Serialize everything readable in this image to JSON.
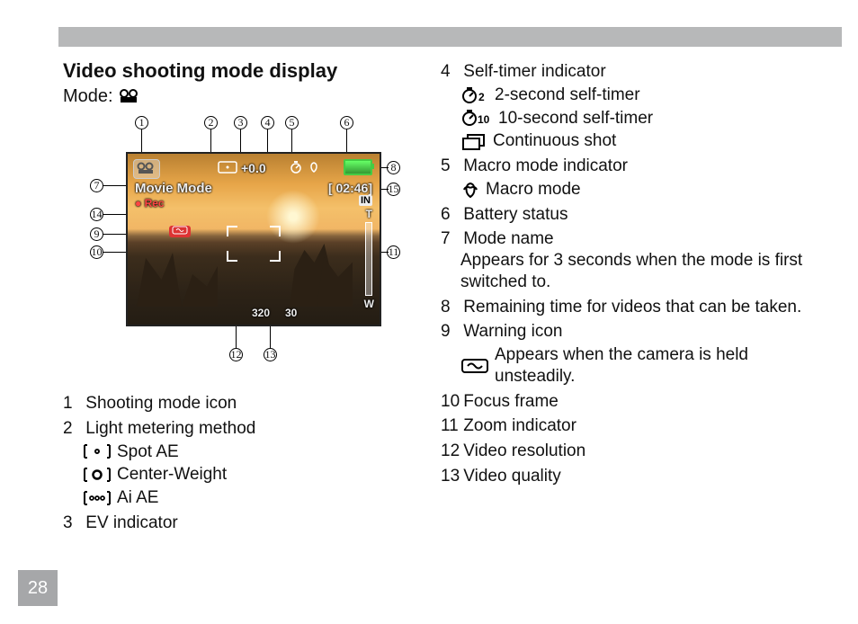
{
  "page_number": "28",
  "title": "Video shooting mode display",
  "mode_label": "Mode:",
  "lcd": {
    "mode_name": "Movie Mode",
    "rec": "Rec",
    "meter": "[ ]",
    "ev": "+0.0",
    "time": "[ 02:46]",
    "in": "IN",
    "zoom_t": "T",
    "zoom_w": "W",
    "warn": "",
    "vres": "320",
    "vq": "30"
  },
  "items": [
    {
      "num": "1",
      "label": "Shooting mode icon"
    },
    {
      "num": "2",
      "label": "Light metering method",
      "subs": [
        {
          "icon": "spot",
          "label": "Spot AE"
        },
        {
          "icon": "center",
          "label": "Center-Weight"
        },
        {
          "icon": "ai",
          "label": "Ai AE"
        }
      ]
    },
    {
      "num": "3",
      "label": "EV indicator"
    },
    {
      "num": "4",
      "label": "Self-timer indicator",
      "subs": [
        {
          "icon": "t2",
          "label": "2-second self-timer"
        },
        {
          "icon": "t10",
          "label": "10-second self-timer"
        },
        {
          "icon": "cont",
          "label": "Continuous shot"
        }
      ]
    },
    {
      "num": "5",
      "label": "Macro mode indicator",
      "subs": [
        {
          "icon": "macro",
          "label": "Macro mode"
        }
      ]
    },
    {
      "num": "6",
      "label": "Battery status"
    },
    {
      "num": "7",
      "label": "Mode name",
      "desc": "Appears for 3 seconds when the mode is first switched to."
    },
    {
      "num": "8",
      "label": "Remaining time for videos that can be taken."
    },
    {
      "num": "9",
      "label": "Warning icon",
      "subs": [
        {
          "icon": "shake",
          "label": "Appears when the camera is held unsteadily."
        }
      ]
    },
    {
      "num": "10",
      "label": "Focus frame"
    },
    {
      "num": "11",
      "label": "Zoom indicator"
    },
    {
      "num": "12",
      "label": "Video resolution"
    },
    {
      "num": "13",
      "label": "Video quality"
    }
  ],
  "callout_numbers": [
    "1",
    "2",
    "3",
    "4",
    "5",
    "6",
    "7",
    "8",
    "9",
    "10",
    "11",
    "12",
    "13",
    "14",
    "15"
  ]
}
